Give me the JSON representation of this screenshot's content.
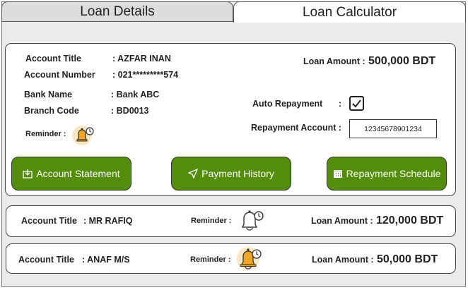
{
  "tabs": [
    {
      "label": "Loan Details"
    },
    {
      "label": "Loan Calculator"
    }
  ],
  "main_card": {
    "account_title_label": "Account Title",
    "account_title_value": ": AZFAR INAN",
    "account_number_label": "Account Number",
    "account_number_value": ":  021*********574",
    "bank_name_label": "Bank Name",
    "bank_name_value": ": Bank ABC",
    "branch_code_label": "Branch Code",
    "branch_code_value": ": BD0013",
    "reminder_label": "Reminder :",
    "loan_amount_label": "Loan Amount :",
    "loan_amount_value": "500,000 BDT",
    "auto_repayment_label": "Auto Repayment",
    "auto_repayment_colon": ":",
    "auto_repayment_checked": true,
    "repayment_account_label": "Repayment Account :",
    "repayment_account_value": "12345678901234",
    "buttons": {
      "statement": "Account Statement",
      "history": "Payment History",
      "schedule": "Repayment Schedule"
    },
    "button_color": "#548c0b"
  },
  "rows": [
    {
      "account_title_label": "Account Title",
      "account_title_value": ": MR RAFIQ",
      "reminder_label": "Reminder :",
      "reminder_icon": "alarm-bell-outline-icon",
      "loan_amount_label": "Loan Amount :",
      "loan_amount_value": "120,000 BDT"
    },
    {
      "account_title_label": "Account Title",
      "account_title_value": ": ANAF M/S",
      "reminder_label": "Reminder :",
      "reminder_icon": "alarm-bell-filled-icon",
      "loan_amount_label": "Loan Amount :",
      "loan_amount_value": "50,000 BDT"
    }
  ]
}
